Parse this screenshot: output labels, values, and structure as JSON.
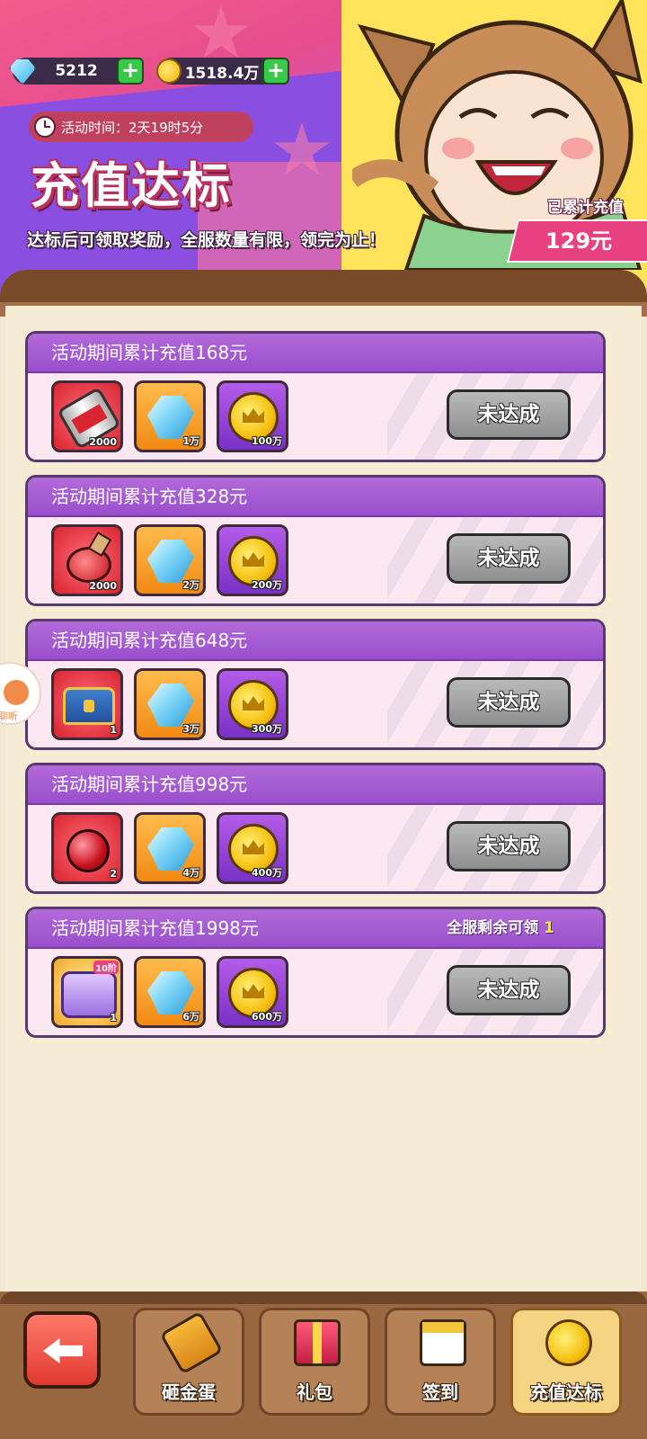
{
  "header": {
    "gems": "5212",
    "gold": "1518.4万",
    "timer_text": "活动时间：2天19时5分",
    "title": "充值达标",
    "description": "达标后可领取奖励，全服数量有限，领完为止！",
    "accumulated_label": "已累计充值",
    "accumulated_value": "129元"
  },
  "tiers": [
    {
      "title": "活动期间累计充值168元",
      "rewards": [
        {
          "icon": "red-bottle-icon",
          "qty": "2000"
        },
        {
          "icon": "diamond-icon",
          "qty": "1万"
        },
        {
          "icon": "gold-coin-icon",
          "qty": "100万"
        }
      ],
      "status": "未达成"
    },
    {
      "title": "活动期间累计充值328元",
      "rewards": [
        {
          "icon": "red-potion-icon",
          "qty": "2000"
        },
        {
          "icon": "diamond-icon",
          "qty": "2万"
        },
        {
          "icon": "gold-coin-icon",
          "qty": "200万"
        }
      ],
      "status": "未达成"
    },
    {
      "title": "活动期间累计充值648元",
      "rewards": [
        {
          "icon": "treasure-chest-icon",
          "qty": "1"
        },
        {
          "icon": "diamond-icon",
          "qty": "3万"
        },
        {
          "icon": "gold-coin-icon",
          "qty": "300万"
        }
      ],
      "status": "未达成"
    },
    {
      "title": "活动期间累计充值998元",
      "rewards": [
        {
          "icon": "red-orb-icon",
          "qty": "2"
        },
        {
          "icon": "diamond-icon",
          "qty": "4万"
        },
        {
          "icon": "gold-coin-icon",
          "qty": "400万"
        }
      ],
      "status": "未达成"
    },
    {
      "title": "活动期间累计充值1998元",
      "remaining_label": "全服剩余可领",
      "remaining_count": "1",
      "rewards": [
        {
          "icon": "purple-chest-icon",
          "qty": "1",
          "tag": "10阶"
        },
        {
          "icon": "diamond-icon",
          "qty": "6万"
        },
        {
          "icon": "gold-coin-icon",
          "qty": "600万"
        }
      ],
      "status": "未达成"
    }
  ],
  "side_widget_text": "聊听",
  "nav": {
    "tabs": [
      {
        "label": "砸金蛋",
        "icon": "hammer-icon"
      },
      {
        "label": "礼包",
        "icon": "gift-icon"
      },
      {
        "label": "签到",
        "icon": "calendar-icon"
      },
      {
        "label": "充值达标",
        "icon": "coin-stack-icon",
        "active": true
      }
    ]
  },
  "colors": {
    "card_header": "#9a4fcc",
    "status_button": "#9e9e9e",
    "accent_pink": "#e8417f",
    "board": "#f6ebd4"
  }
}
